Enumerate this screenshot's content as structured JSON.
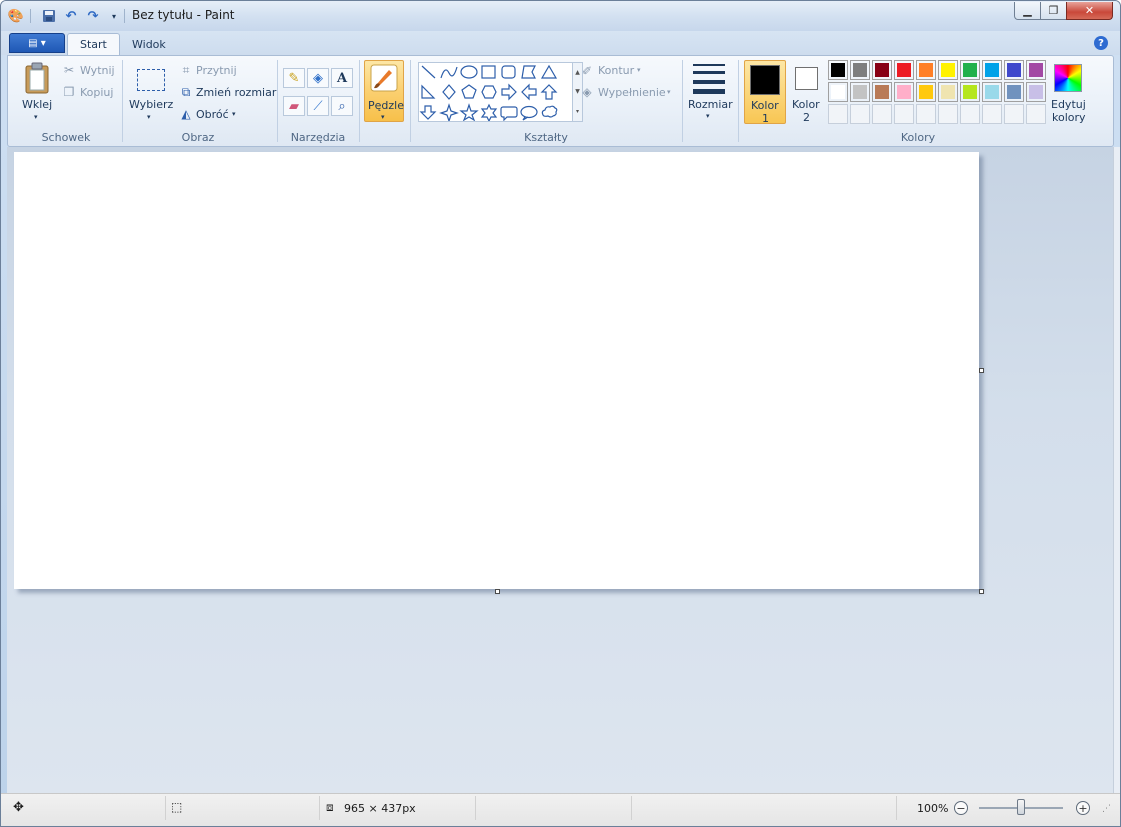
{
  "window": {
    "title": "Bez tytułu - Paint",
    "controls": [
      "minimize",
      "maximize",
      "close"
    ]
  },
  "tabs": [
    {
      "label": "Start",
      "active": true
    },
    {
      "label": "Widok",
      "active": false
    }
  ],
  "ribbon": {
    "clipboard": {
      "group": "Schowek",
      "paste": "Wklej",
      "cut": "Wytnij",
      "copy": "Kopiuj"
    },
    "image": {
      "group": "Obraz",
      "select": "Wybierz",
      "crop": "Przytnij",
      "resize": "Zmień rozmiar",
      "rotate": "Obróć"
    },
    "tools": {
      "group": "Narzędzia"
    },
    "brushes": {
      "label": "Pędzle"
    },
    "shapes": {
      "group": "Kształty",
      "outline": "Kontur",
      "fill": "Wypełnienie"
    },
    "size": {
      "label": "Rozmiar"
    },
    "colors": {
      "group": "Kolory",
      "color1": {
        "line1": "Kolor",
        "line2": "1",
        "value": "#000000"
      },
      "color2": {
        "line1": "Kolor",
        "line2": "2",
        "value": "#ffffff"
      },
      "edit": {
        "line1": "Edytuj",
        "line2": "kolory"
      },
      "palette_row1": [
        "#000000",
        "#7f7f7f",
        "#880015",
        "#ed1c24",
        "#ff7f27",
        "#fff200",
        "#22b14c",
        "#00a2e8",
        "#3f48cc",
        "#a349a4"
      ],
      "palette_row2": [
        "#ffffff",
        "#c3c3c3",
        "#b97a57",
        "#ffaec9",
        "#ffc90e",
        "#efe4b0",
        "#b5e61d",
        "#99d9ea",
        "#7092be",
        "#c8bfe7"
      ]
    }
  },
  "status": {
    "image_size": "965 × 437px",
    "zoom": "100%"
  }
}
